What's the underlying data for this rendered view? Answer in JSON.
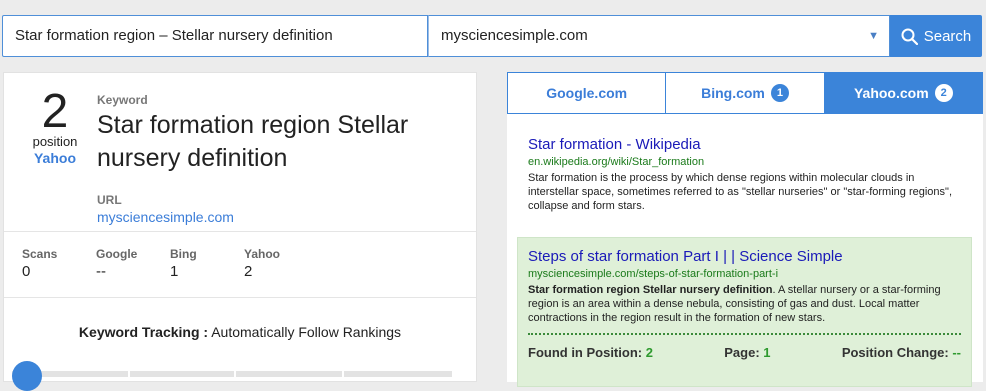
{
  "search": {
    "keyword_value": "Star formation region – Stellar nursery definition",
    "site_value": "mysciencesimple.com",
    "button_label": "Search"
  },
  "summary": {
    "position": "2",
    "position_label": "position",
    "engine": "Yahoo",
    "keyword_label": "Keyword",
    "keyword": "Star formation region Stellar nursery definition",
    "url_label": "URL",
    "url": "mysciencesimple.com"
  },
  "stats": [
    {
      "label": "Scans",
      "value": "0"
    },
    {
      "label": "Google",
      "value": "--"
    },
    {
      "label": "Bing",
      "value": "1"
    },
    {
      "label": "Yahoo",
      "value": "2"
    }
  ],
  "tracking": {
    "label": "Keyword Tracking :",
    "value": "Automatically Follow Rankings"
  },
  "tabs": [
    {
      "label": "Google.com",
      "badge": ""
    },
    {
      "label": "Bing.com",
      "badge": "1"
    },
    {
      "label": "Yahoo.com",
      "badge": "2"
    }
  ],
  "results": [
    {
      "title": "Star formation - Wikipedia",
      "url": "en.wikipedia.org/wiki/Star_formation",
      "desc": "Star formation is the process by which dense regions within molecular clouds in interstellar space, sometimes referred to as \"stellar nurseries\" or \"star-forming regions\", collapse and form stars."
    },
    {
      "title": "Steps of star formation Part I | | Science Simple",
      "url": "mysciencesimple.com/steps-of-star-formation-part-i",
      "desc_bold": "Star formation region Stellar nursery definition",
      "desc_rest": ". A stellar nursery or a star-forming region is an area within a dense nebula, consisting of gas and dust. Local matter contractions in the region result in the formation of new stars."
    }
  ],
  "found": {
    "position_label": "Found in Position:",
    "position_value": "2",
    "page_label": "Page:",
    "page_value": "1",
    "change_label": "Position Change:",
    "change_value": "--"
  },
  "colors": {
    "accent": "#3b84d9",
    "highlight_bg": "#dff0d8",
    "link_title": "#1a1ab8",
    "link_url": "#1a7a1a"
  }
}
